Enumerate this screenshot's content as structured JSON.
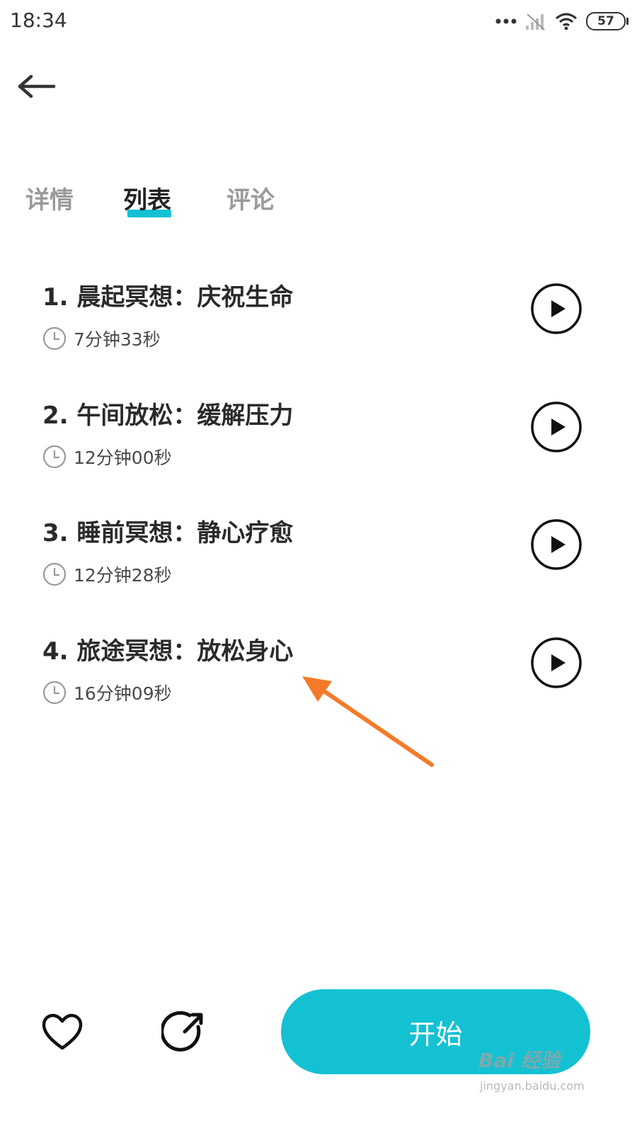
{
  "status_bar": {
    "time": "18:34",
    "battery": "57"
  },
  "tabs": [
    {
      "label": "详情",
      "active": false
    },
    {
      "label": "列表",
      "active": true
    },
    {
      "label": "评论",
      "active": false
    }
  ],
  "tracks": [
    {
      "title": "1. 晨起冥想：庆祝生命",
      "duration": "7分钟33秒"
    },
    {
      "title": "2. 午间放松：缓解压力",
      "duration": "12分钟00秒"
    },
    {
      "title": "3. 睡前冥想：静心疗愈",
      "duration": "12分钟28秒"
    },
    {
      "title": "4. 旅途冥想：放松身心",
      "duration": "16分钟09秒"
    }
  ],
  "bottom": {
    "start_label": "开始"
  },
  "watermark": {
    "logo": "Bai 经验",
    "url": "jingyan.baidu.com"
  },
  "colors": {
    "accent": "#14c1d2",
    "annotation_arrow": "#f47a28"
  },
  "icons": [
    "back-arrow-icon",
    "clock-icon",
    "play-icon",
    "heart-icon",
    "share-icon",
    "signal-icon",
    "wifi-icon",
    "battery-icon"
  ]
}
